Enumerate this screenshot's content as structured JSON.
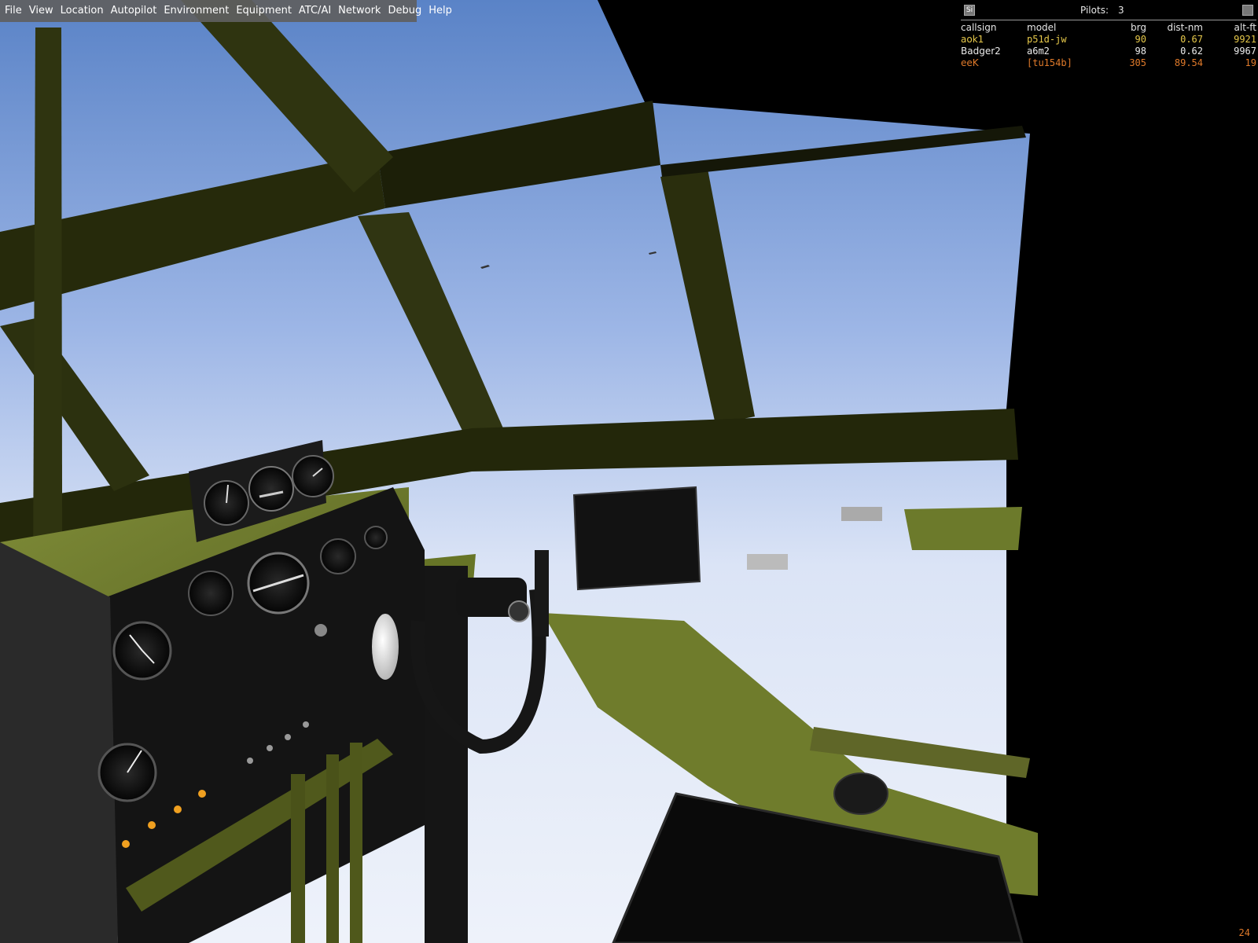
{
  "menubar": {
    "items": [
      "File",
      "View",
      "Location",
      "Autopilot",
      "Environment",
      "Equipment",
      "ATC/AI",
      "Network",
      "Debug",
      "Help"
    ]
  },
  "multiplayer": {
    "left_button": "Si",
    "pilots_label": "Pilots:",
    "pilots_count": "3",
    "columns": [
      "callsign",
      "model",
      "brg",
      "dist-nm",
      "alt-ft"
    ],
    "rows": [
      {
        "callsign": "aok1",
        "model": "p51d-jw",
        "brg": "90",
        "dist": "0.67",
        "alt": "9921",
        "color": "#e6c84a"
      },
      {
        "callsign": "Badger2",
        "model": "a6m2",
        "brg": "98",
        "dist": "0.62",
        "alt": "9967",
        "color": "#ececec"
      },
      {
        "callsign": "eeK",
        "model": "[tu154b]",
        "brg": "305",
        "dist": "89.54",
        "alt": "19",
        "color": "#e07a2a"
      }
    ]
  },
  "fps": "24",
  "colors": {
    "sky_top": "#5a83c7",
    "sky_horizon": "#e6ecf8",
    "frame": "#2b2f0e",
    "interior_green": "#6e7a2e",
    "panel_black": "#1a1a1a"
  }
}
